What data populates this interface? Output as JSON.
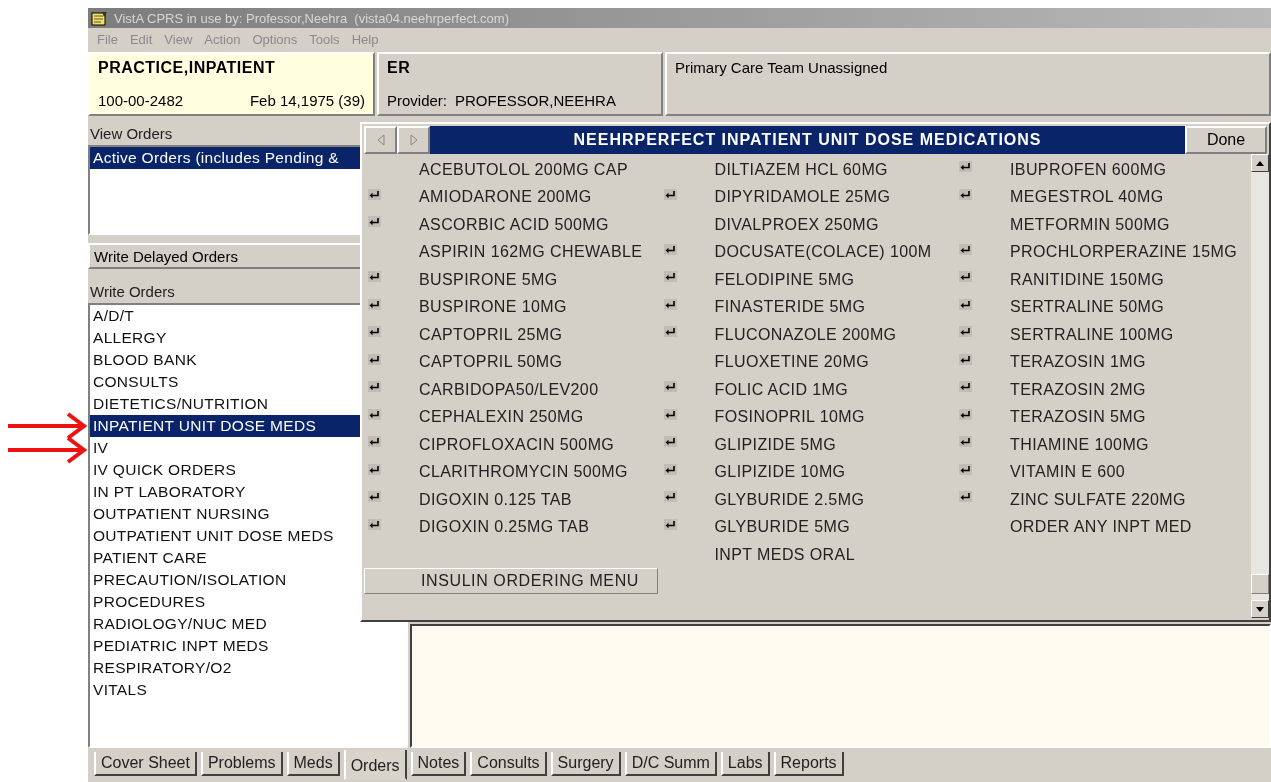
{
  "window": {
    "title": "VistA CPRS in use by: Professor,Neehra  (vista04.neehrperfect.com)"
  },
  "menu": [
    {
      "label": "File",
      "disabled": true
    },
    {
      "label": "Edit",
      "disabled": true
    },
    {
      "label": "View",
      "disabled": true
    },
    {
      "label": "Action",
      "disabled": true
    },
    {
      "label": "Options",
      "disabled": true
    },
    {
      "label": "Tools",
      "disabled": true
    },
    {
      "label": "Help",
      "disabled": true
    }
  ],
  "patient": {
    "name": "PRACTICE,INPATIENT",
    "id": "100-00-2482",
    "dob": "Feb 14,1975 (39)"
  },
  "location": {
    "name": "ER",
    "provider_label": "Provider:",
    "provider": "PROFESSOR,NEEHRA"
  },
  "care_team": "Primary Care Team Unassigned",
  "view_orders": {
    "label": "View Orders",
    "items": [
      {
        "label": "Active Orders (includes Pending &",
        "selected": true
      }
    ]
  },
  "delayed_button": "Write Delayed Orders",
  "write_orders": {
    "label": "Write Orders",
    "items": [
      {
        "label": "A/D/T",
        "selected": false
      },
      {
        "label": "ALLERGY",
        "selected": false
      },
      {
        "label": "BLOOD BANK",
        "selected": false
      },
      {
        "label": "CONSULTS",
        "selected": false
      },
      {
        "label": "DIETETICS/NUTRITION",
        "selected": false
      },
      {
        "label": "INPATIENT UNIT DOSE MEDS",
        "selected": true
      },
      {
        "label": "IV",
        "selected": false
      },
      {
        "label": "IV QUICK ORDERS",
        "selected": false
      },
      {
        "label": "IN PT LABORATORY",
        "selected": false
      },
      {
        "label": "OUTPATIENT NURSING",
        "selected": false
      },
      {
        "label": "OUTPATIENT UNIT DOSE MEDS",
        "selected": false
      },
      {
        "label": "PATIENT CARE",
        "selected": false
      },
      {
        "label": "PRECAUTION/ISOLATION",
        "selected": false
      },
      {
        "label": "PROCEDURES",
        "selected": false
      },
      {
        "label": "RADIOLOGY/NUC MED",
        "selected": false
      },
      {
        "label": "PEDIATRIC INPT MEDS",
        "selected": false
      },
      {
        "label": "RESPIRATORY/O2",
        "selected": false
      },
      {
        "label": "VITALS",
        "selected": false
      }
    ]
  },
  "popup": {
    "title": "NEEHRPERFECT INPATIENT UNIT DOSE MEDICATIONS",
    "done": "Done",
    "columns": [
      [
        {
          "label": "ACEBUTOLOL 200MG CAP",
          "marked": false
        },
        {
          "label": "AMIODARONE 200MG",
          "marked": true
        },
        {
          "label": "ASCORBIC ACID 500MG",
          "marked": true
        },
        {
          "label": "ASPIRIN 162MG CHEWABLE",
          "marked": false
        },
        {
          "label": "BUSPIRONE 5MG",
          "marked": true
        },
        {
          "label": "BUSPIRONE 10MG",
          "marked": true
        },
        {
          "label": "CAPTOPRIL 25MG",
          "marked": true
        },
        {
          "label": "CAPTOPRIL 50MG",
          "marked": true
        },
        {
          "label": "CARBIDOPA50/LEV200",
          "marked": true
        },
        {
          "label": "CEPHALEXIN 250MG",
          "marked": true
        },
        {
          "label": "CIPROFLOXACIN 500MG",
          "marked": true
        },
        {
          "label": "CLARITHROMYCIN 500MG",
          "marked": true
        },
        {
          "label": "DIGOXIN 0.125 TAB",
          "marked": true
        },
        {
          "label": "DIGOXIN 0.25MG TAB",
          "marked": true
        }
      ],
      [
        {
          "label": "DILTIAZEM HCL 60MG",
          "marked": false
        },
        {
          "label": "DIPYRIDAMOLE 25MG",
          "marked": true
        },
        {
          "label": "DIVALPROEX 250MG",
          "marked": false
        },
        {
          "label": "DOCUSATE(COLACE) 100M",
          "marked": true
        },
        {
          "label": "FELODIPINE 5MG",
          "marked": true
        },
        {
          "label": "FINASTERIDE 5MG",
          "marked": true
        },
        {
          "label": "FLUCONAZOLE 200MG",
          "marked": true
        },
        {
          "label": "FLUOXETINE 20MG",
          "marked": false
        },
        {
          "label": "FOLIC ACID 1MG",
          "marked": true
        },
        {
          "label": "FOSINOPRIL 10MG",
          "marked": true
        },
        {
          "label": "GLIPIZIDE 5MG",
          "marked": true
        },
        {
          "label": "GLIPIZIDE 10MG",
          "marked": true
        },
        {
          "label": "GLYBURIDE 2.5MG",
          "marked": true
        },
        {
          "label": "GLYBURIDE 5MG",
          "marked": true
        },
        {
          "label": "INPT MEDS ORAL",
          "marked": false
        }
      ],
      [
        {
          "label": "IBUPROFEN 600MG",
          "marked": true
        },
        {
          "label": "MEGESTROL 40MG",
          "marked": true
        },
        {
          "label": "METFORMIN 500MG",
          "marked": false
        },
        {
          "label": "PROCHLORPERAZINE 15MG",
          "marked": true
        },
        {
          "label": "RANITIDINE 150MG",
          "marked": true
        },
        {
          "label": "SERTRALINE 50MG",
          "marked": true
        },
        {
          "label": "SERTRALINE 100MG",
          "marked": true
        },
        {
          "label": "TERAZOSIN 1MG",
          "marked": true
        },
        {
          "label": "TERAZOSIN 2MG",
          "marked": true
        },
        {
          "label": "TERAZOSIN 5MG",
          "marked": true
        },
        {
          "label": "THIAMINE 100MG",
          "marked": true
        },
        {
          "label": "VITAMIN E 600",
          "marked": true
        },
        {
          "label": "ZINC SULFATE 220MG",
          "marked": true
        },
        {
          "label": "ORDER ANY INPT MED",
          "marked": false
        }
      ]
    ],
    "insulin_button": "INSULIN ORDERING MENU"
  },
  "tabs": [
    {
      "label": "Cover Sheet",
      "selected": false
    },
    {
      "label": "Problems",
      "selected": false
    },
    {
      "label": "Meds",
      "selected": false
    },
    {
      "label": "Orders",
      "selected": true
    },
    {
      "label": "Notes",
      "selected": false
    },
    {
      "label": "Consults",
      "selected": false
    },
    {
      "label": "Surgery",
      "selected": false
    },
    {
      "label": "D/C Summ",
      "selected": false
    },
    {
      "label": "Labs",
      "selected": false
    },
    {
      "label": "Reports",
      "selected": false
    }
  ]
}
